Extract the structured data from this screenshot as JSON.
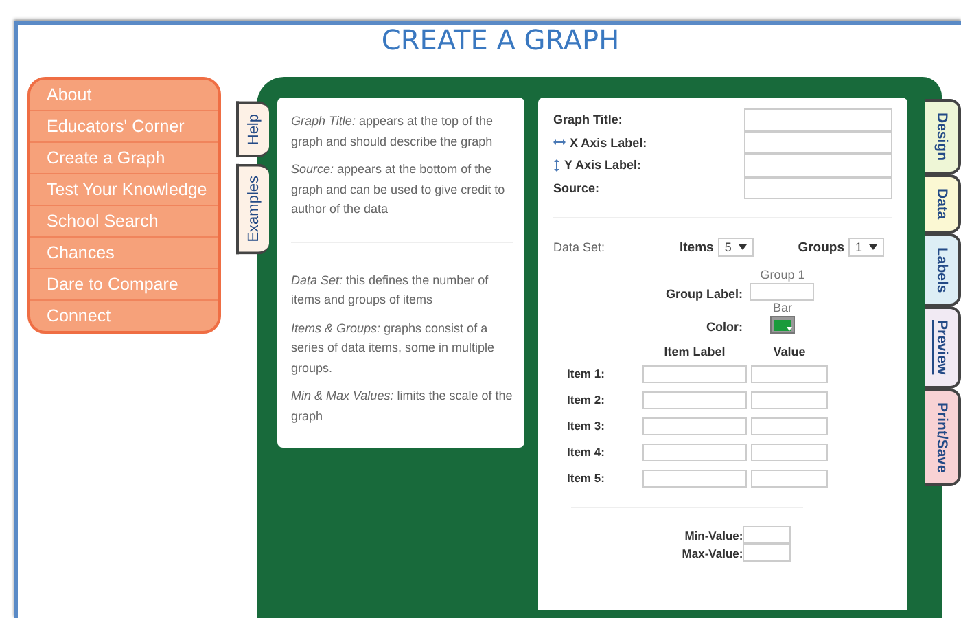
{
  "page_title": "CREATE A GRAPH",
  "sidebar": {
    "items": [
      {
        "label": "About"
      },
      {
        "label": "Educators' Corner"
      },
      {
        "label": "Create a Graph"
      },
      {
        "label": "Test Your Knowledge"
      },
      {
        "label": "School Search"
      },
      {
        "label": "Chances"
      },
      {
        "label": "Dare to Compare"
      },
      {
        "label": "Connect"
      }
    ]
  },
  "left_tabs": [
    {
      "label": "Help"
    },
    {
      "label": "Examples"
    }
  ],
  "help": {
    "sections": [
      [
        "*Graph Title:* appears at the top of the graph and should describe the graph",
        "*Source:* appears at the bottom of the graph and can be used to give credit to author of the data"
      ],
      [
        "*Data Set:* this defines the number of items and groups of items",
        "*Items & Groups:* graphs consist of a series of data items, some in multiple groups.",
        "*Min & Max Values:* limits the scale of the graph"
      ]
    ]
  },
  "form": {
    "text_fields": [
      {
        "label": "Graph Title:",
        "kind": "plain"
      },
      {
        "label": "X Axis Label:",
        "kind": "x_axis"
      },
      {
        "label": "Y Axis Label:",
        "kind": "y_axis"
      },
      {
        "label": "Source:",
        "kind": "plain"
      }
    ],
    "data_set": {
      "label": "Data Set:",
      "items_label": "Items",
      "items_value": "5",
      "groups_label": "Groups",
      "groups_value": "1"
    },
    "group": {
      "header": "Group 1",
      "label_caption": "Group Label:",
      "series_caption": "Bar",
      "color_caption": "Color:",
      "color": "#1a9b3c"
    },
    "item_columns": [
      "Item Label",
      "Value"
    ],
    "items": [
      {
        "label": "Item 1:"
      },
      {
        "label": "Item 2:"
      },
      {
        "label": "Item 3:"
      },
      {
        "label": "Item 4:"
      },
      {
        "label": "Item 5:"
      }
    ],
    "min_label": "Min-Value:",
    "max_label": "Max-Value:"
  },
  "right_tabs": [
    {
      "label": "Design",
      "color": "#eef6d6",
      "hovered": false
    },
    {
      "label": "Data",
      "color": "#fbf8d3",
      "hovered": false
    },
    {
      "label": "Labels",
      "color": "#ddeef5",
      "hovered": false
    },
    {
      "label": "Preview",
      "color": "#f1eaf3",
      "hovered": true
    },
    {
      "label": "Print/Save",
      "color": "#f8d2d4",
      "hovered": false
    }
  ]
}
